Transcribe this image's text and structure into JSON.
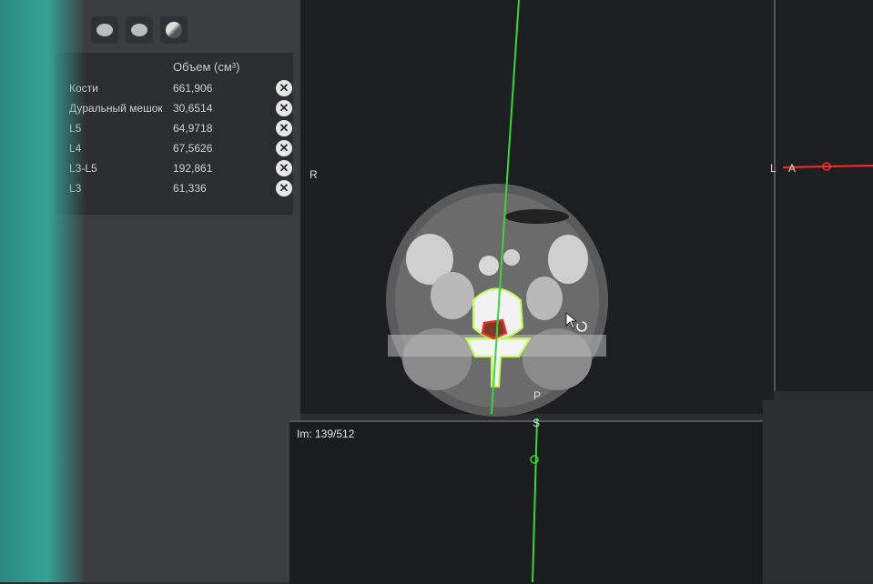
{
  "toolbar": {
    "icons": [
      "brain-icon",
      "eye-icon",
      "sphere-icon"
    ]
  },
  "table": {
    "column_header": "Объем (см³)",
    "rows": [
      {
        "name": "Кости",
        "volume": "661,906"
      },
      {
        "name": "Дуральный мешок",
        "volume": "30,6514"
      },
      {
        "name": "L5",
        "volume": "64,9718"
      },
      {
        "name": "L4",
        "volume": "67,5626"
      },
      {
        "name": "L3-L5",
        "volume": "192,861"
      },
      {
        "name": "L3",
        "volume": "61,336"
      }
    ],
    "delete_glyph": "✕"
  },
  "viewer": {
    "orient_left": "R",
    "orient_right": "L",
    "orient_right_b": "A",
    "orient_bottom": "P",
    "orient_top_bottom_view": "S",
    "slice_info": "Im: 139/512"
  },
  "colors": {
    "crosshair": "#3ed23e",
    "segmentation_outline": "#b8ff4d",
    "dural_sac": "#e0342b",
    "red_line": "#ff2a2a"
  }
}
